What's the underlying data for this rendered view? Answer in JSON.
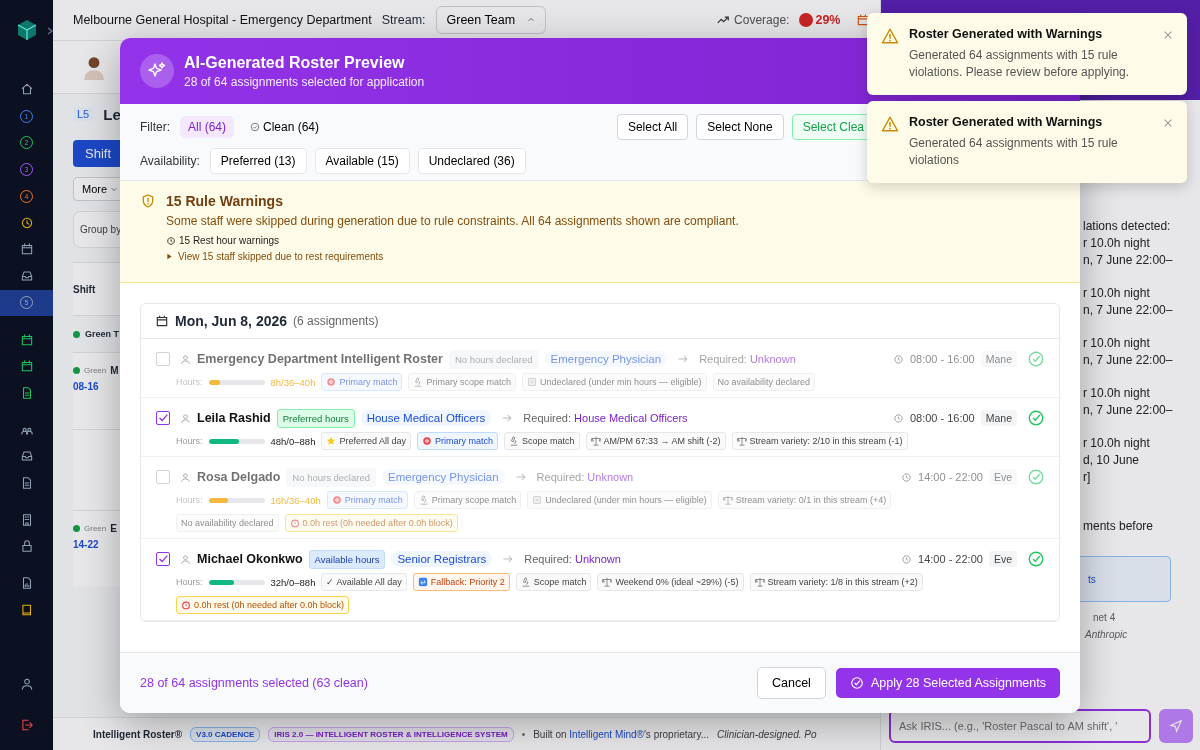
{
  "sidebar": {
    "groups": [
      {
        "items": [
          {
            "kind": "icon",
            "selected": false
          },
          {
            "kind": "number",
            "label": "1",
            "selected": false
          },
          {
            "kind": "number",
            "label": "2",
            "selected": false
          },
          {
            "kind": "number",
            "label": "3",
            "selected": false
          },
          {
            "kind": "number",
            "label": "4",
            "selected": false
          },
          {
            "kind": "icon",
            "selected": false
          },
          {
            "kind": "icon",
            "selected": false
          },
          {
            "kind": "icon",
            "selected": false
          },
          {
            "kind": "number",
            "label": "5",
            "selected": true
          }
        ]
      },
      {
        "items": [
          {
            "kind": "icon",
            "selected": false
          },
          {
            "kind": "icon",
            "selected": false
          },
          {
            "kind": "icon",
            "selected": false
          }
        ]
      },
      {
        "items": [
          {
            "kind": "icon",
            "selected": false
          },
          {
            "kind": "icon",
            "selected": false
          },
          {
            "kind": "icon",
            "selected": false
          }
        ]
      },
      {
        "items": [
          {
            "kind": "icon",
            "selected": false
          },
          {
            "kind": "icon",
            "selected": false
          }
        ]
      },
      {
        "items": [
          {
            "kind": "icon",
            "selected": false
          },
          {
            "kind": "icon",
            "selected": false
          }
        ]
      }
    ],
    "bottom": [
      {
        "kind": "icon",
        "selected": false
      },
      {
        "kind": "icon",
        "selected": false
      }
    ]
  },
  "topbar": {
    "title": "Melbourne General Hospital - Emergency Department",
    "stream_label": "Stream:",
    "stream_value": "Green Team",
    "coverage_label": "Coverage:",
    "coverage_value": "29%"
  },
  "page": {
    "tag": "L5",
    "title": "Le",
    "view_button": "Shift",
    "more_button": "More",
    "group_by": "Group by",
    "column": "Shift",
    "rows": [
      {
        "kind": "group",
        "stream": "Green T"
      },
      {
        "kind": "shift",
        "stream": "Green",
        "name": "M",
        "time": "08-16"
      },
      {
        "kind": "empty"
      },
      {
        "kind": "shift",
        "stream": "Green",
        "name": "E",
        "time": "14-22"
      }
    ]
  },
  "footer": {
    "brand": "Intelligent Roster®",
    "badges": [
      {
        "text": "V3.0 CADENCE",
        "kind": "blue"
      },
      {
        "text": "IRIS 2.0 — INTELLIGENT ROSTER & INTELLIGENCE SYSTEM",
        "kind": "purple"
      }
    ],
    "bullet": "•",
    "built_prefix": "Built on",
    "built_link": "Intelligent Mind®",
    "built_suffix": "'s proprietary...",
    "tagline": "Clinician-designed. Po"
  },
  "chat": {
    "paragraphs": [
      [
        "lations detected:",
        "r 10.0h night",
        "n, 7 June 22:00–"
      ],
      [
        "r 10.0h night",
        "n, 7 June 22:00–"
      ],
      [
        "r 10.0h night",
        "n, 7 June 22:00–"
      ],
      [
        "r 10.0h night",
        "n, 7 June 22:00–"
      ],
      [
        "r 10.0h night",
        "d, 10 June",
        "r]"
      ],
      [
        "ments before"
      ]
    ],
    "card": "ts",
    "model": "net 4",
    "provider": "Anthropic",
    "placeholder": "Ask IRIS... (e.g., 'Roster Pascal to AM shift', '"
  },
  "modal": {
    "title": "AI-Generated Roster Preview",
    "subtitle": "28 of 64 assignments selected for application",
    "filter_label": "Filter:",
    "filters": [
      {
        "label": "All (64)",
        "kind": "plain",
        "selected": true
      },
      {
        "label": "Clean (64)",
        "kind": "clean",
        "selected": false
      }
    ],
    "actions": [
      {
        "label": "Select All",
        "kind": "default"
      },
      {
        "label": "Select None",
        "kind": "default"
      },
      {
        "label": "Select Clea",
        "kind": "green"
      }
    ],
    "availability_label": "Availability:",
    "availability": [
      {
        "label": "Preferred (13)",
        "selected": false
      },
      {
        "label": "Available (15)",
        "selected": false
      },
      {
        "label": "Undeclared (36)",
        "selected": false
      }
    ],
    "warning": {
      "title": "15 Rule Warnings",
      "text": "Some staff were skipped during generation due to rule constraints. All 64 assignments shown are compliant.",
      "rest": "15 Rest hour warnings",
      "skipped": "View 15 staff skipped due to rest requirements",
      "expanded": false
    },
    "day": {
      "date": "Mon, Jun 8, 2026",
      "count": "(6 assignments)"
    },
    "rows": [
      {
        "checked": false,
        "name": "Emergency Department Intelligent Roster",
        "badge": {
          "kind": "none",
          "text": "No hours declared"
        },
        "role": "Emergency Physician",
        "required_label": "Required:",
        "required": "Unknown",
        "time": "08:00 - 16:00",
        "shift": "Mane",
        "valid": true,
        "hours_label": "Hours:",
        "hours": {
          "level": 0.2,
          "text": "8h/36–40h",
          "color": "#f5b83d"
        },
        "chips": [
          {
            "kind": "primary",
            "text": "Primary match"
          },
          {
            "kind": "scope",
            "text": "Primary scope match"
          },
          {
            "kind": "undeclared",
            "text": "Undeclared (under min hours — eligible)"
          },
          {
            "kind": "plain",
            "text": "No availability declared"
          }
        ]
      },
      {
        "checked": true,
        "name": "Leila Rashid",
        "badge": {
          "kind": "preferred",
          "text": "Preferred hours"
        },
        "role": "House Medical Officers",
        "required_label": "Required:",
        "required": "House Medical Officers",
        "time": "08:00 - 16:00",
        "shift": "Mane",
        "valid": true,
        "hours_label": "Hours:",
        "hours": {
          "level": 0.55,
          "text": "48h/0–88h",
          "color": "#10b981"
        },
        "chips": [
          {
            "kind": "preferred",
            "text": "Preferred All day"
          },
          {
            "kind": "primary",
            "text": "Primary match"
          },
          {
            "kind": "scope",
            "text": "Scope match"
          },
          {
            "kind": "balance",
            "text": "AM/PM 67:33 → AM shift (-2)"
          },
          {
            "kind": "balance",
            "text": "Stream variety: 2/10 in this stream (-1)"
          }
        ]
      },
      {
        "checked": false,
        "name": "Rosa Delgado",
        "badge": {
          "kind": "none",
          "text": "No hours declared"
        },
        "role": "Emergency Physician",
        "required_label": "Required:",
        "required": "Unknown",
        "time": "14:00 - 22:00",
        "shift": "Eve",
        "valid": true,
        "hours_label": "Hours:",
        "hours": {
          "level": 0.35,
          "text": "16h/36–40h",
          "color": "#f5b83d"
        },
        "chips": [
          {
            "kind": "primary",
            "text": "Primary match"
          },
          {
            "kind": "scope",
            "text": "Primary scope match"
          },
          {
            "kind": "undeclared",
            "text": "Undeclared (under min hours — eligible)"
          },
          {
            "kind": "balance",
            "text": "Stream variety: 0/1 in this stream (+4)"
          },
          {
            "kind": "plain",
            "text": "No availability declared"
          },
          {
            "kind": "rest",
            "text": "0.0h rest (0h needed after 0.0h block)"
          }
        ]
      },
      {
        "checked": true,
        "name": "Michael Okonkwo",
        "badge": {
          "kind": "available",
          "text": "Available hours"
        },
        "role": "Senior Registrars",
        "required_label": "Required:",
        "required": "Unknown",
        "time": "14:00 - 22:00",
        "shift": "Eve",
        "valid": true,
        "hours_label": "Hours:",
        "hours": {
          "level": 0.45,
          "text": "32h/0–88h",
          "color": "#10b981"
        },
        "chips": [
          {
            "kind": "plain",
            "text": "✓ Available All day"
          },
          {
            "kind": "fallback",
            "text": "Fallback: Priority 2"
          },
          {
            "kind": "scope",
            "text": "Scope match"
          },
          {
            "kind": "balance",
            "text": "Weekend 0% (ideal ~29%) (-5)"
          },
          {
            "kind": "balance",
            "text": "Stream variety: 1/8 in this stream (+2)"
          },
          {
            "kind": "rest",
            "text": "0.0h rest (0h needed after 0.0h block)"
          }
        ]
      }
    ],
    "summary": "28 of 64 assignments selected (63 clean)",
    "cancel": "Cancel",
    "apply": "Apply 28 Selected Assignments"
  },
  "toasts": [
    {
      "title": "Roster Generated with Warnings",
      "text": "Generated 64 assignments with 15 rule violations. Please review before applying."
    },
    {
      "title": "Roster Generated with Warnings",
      "text": "Generated 64 assignments with 15 rule violations"
    }
  ]
}
